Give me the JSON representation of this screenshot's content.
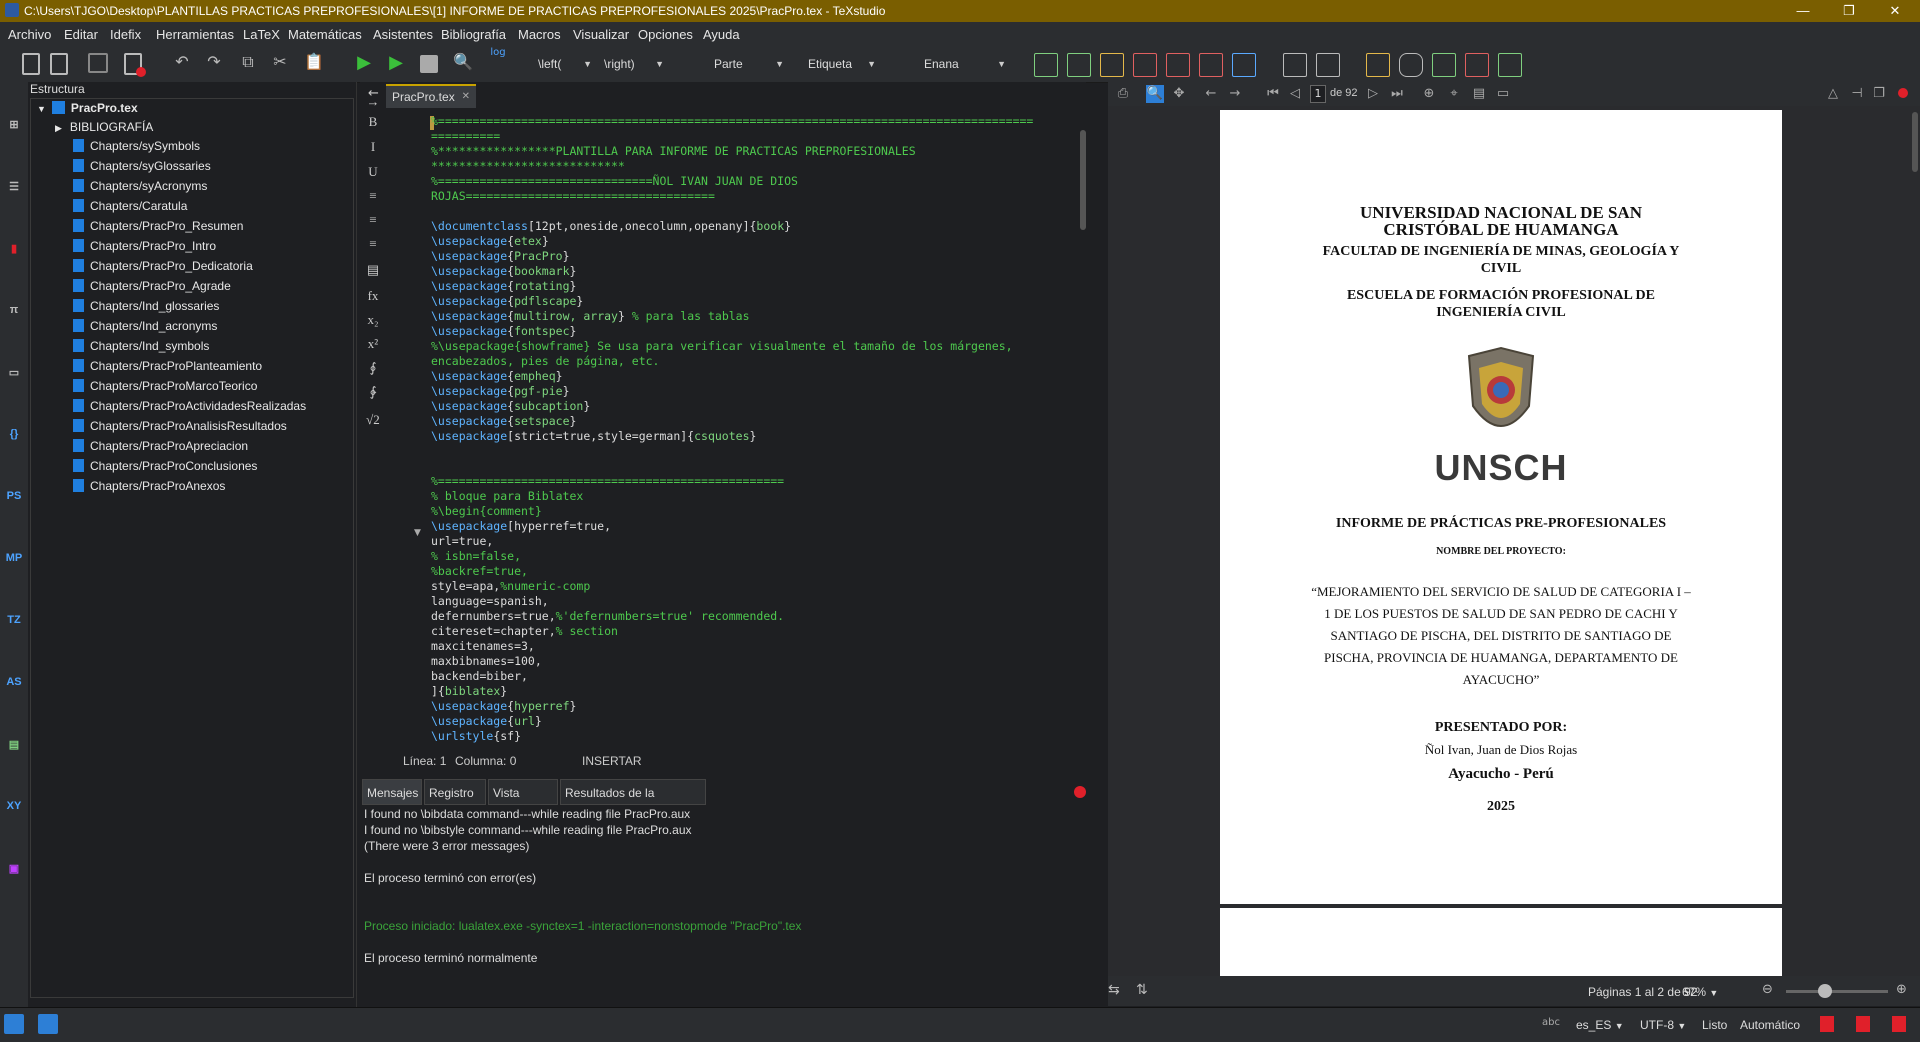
{
  "window": {
    "title": "C:\\Users\\TJGO\\Desktop\\PLANTILLAS PRACTICAS PREPROFESIONALES\\[1] INFORME DE PRACTICAS PREPROFESIONALES 2025\\PracPro.tex - TeXstudio",
    "minimize": "—",
    "maximize": "❐",
    "close": "✕"
  },
  "menu": [
    "Archivo",
    "Editar",
    "Idefix",
    "Herramientas",
    "LaTeX",
    "Matemáticas",
    "Asistentes",
    "Bibliografía",
    "Macros",
    "Visualizar",
    "Opciones",
    "Ayuda"
  ],
  "toolbar": {
    "left_cmd": "\\left(",
    "right_cmd": "\\right)",
    "part": "Parte",
    "label": "Etiqueta",
    "size": "Enana",
    "log": "log"
  },
  "structure": {
    "header": "Estructura",
    "root": "PracPro.tex",
    "bibliography": "BIBLIOGRAFÍA",
    "items": [
      "Chapters/sySymbols",
      "Chapters/syGlossaries",
      "Chapters/syAcronyms",
      "Chapters/Caratula",
      "Chapters/PracPro_Resumen",
      "Chapters/PracPro_Intro",
      "Chapters/PracPro_Dedicatoria",
      "Chapters/PracPro_Agrade",
      "Chapters/Ind_glossaries",
      "Chapters/Ind_acronyms",
      "Chapters/Ind_symbols",
      "Chapters/PracProPlanteamiento",
      "Chapters/PracProMarcoTeorico",
      "Chapters/PracProActividadesRealizadas",
      "Chapters/PracProAnalisisResultados",
      "Chapters/PracProApreciacion",
      "Chapters/PracProConclusiones",
      "Chapters/PracProAnexos"
    ]
  },
  "editor_strip": [
    "→",
    "B",
    "I",
    "U",
    "≡",
    "≡",
    "≡",
    "▤",
    "fx",
    "x₂",
    "x²",
    "∮",
    "∲",
    "√2"
  ],
  "tab": {
    "label": "PracPro.tex",
    "close": "✕"
  },
  "code": [
    [
      [
        "cm",
        "%======================================================================================"
      ]
    ],
    [
      [
        "cm",
        "=========="
      ]
    ],
    [
      [
        "cm",
        "%*****************PLANTILLA PARA INFORME DE PRACTICAS PREPROFESIONALES"
      ]
    ],
    [
      [
        "cm",
        "****************************"
      ]
    ],
    [
      [
        "cm",
        "%===============================ÑOL IVAN JUAN DE DIOS"
      ]
    ],
    [
      [
        "cm",
        "ROJAS===================================="
      ]
    ],
    [
      [
        "tx",
        ""
      ]
    ],
    [
      [
        "kw",
        "\\documentclass"
      ],
      [
        "tx",
        "[12pt,oneside,onecolumn,openany]{"
      ],
      [
        "br",
        "book"
      ],
      [
        "tx",
        "}"
      ]
    ],
    [
      [
        "kw",
        "\\usepackage"
      ],
      [
        "tx",
        "{"
      ],
      [
        "br",
        "etex"
      ],
      [
        "tx",
        "}"
      ]
    ],
    [
      [
        "kw",
        "\\usepackage"
      ],
      [
        "tx",
        "{"
      ],
      [
        "br",
        "PracPro"
      ],
      [
        "tx",
        "}"
      ]
    ],
    [
      [
        "kw",
        "\\usepackage"
      ],
      [
        "tx",
        "{"
      ],
      [
        "br",
        "bookmark"
      ],
      [
        "tx",
        "}"
      ]
    ],
    [
      [
        "kw",
        "\\usepackage"
      ],
      [
        "tx",
        "{"
      ],
      [
        "br",
        "rotating"
      ],
      [
        "tx",
        "}"
      ]
    ],
    [
      [
        "kw",
        "\\usepackage"
      ],
      [
        "tx",
        "{"
      ],
      [
        "br",
        "pdflscape"
      ],
      [
        "tx",
        "}"
      ]
    ],
    [
      [
        "kw",
        "\\usepackage"
      ],
      [
        "tx",
        "{"
      ],
      [
        "br",
        "multirow, array"
      ],
      [
        "tx",
        "} "
      ],
      [
        "cm",
        "% para las tablas"
      ]
    ],
    [
      [
        "kw",
        "\\usepackage"
      ],
      [
        "tx",
        "{"
      ],
      [
        "br",
        "fontspec"
      ],
      [
        "tx",
        "}"
      ]
    ],
    [
      [
        "cm",
        "%\\usepackage{showframe} Se usa para verificar visualmente el tamaño de los márgenes,"
      ]
    ],
    [
      [
        "cm",
        "encabezados, pies de página, etc."
      ]
    ],
    [
      [
        "kw",
        "\\usepackage"
      ],
      [
        "tx",
        "{"
      ],
      [
        "br",
        "empheq"
      ],
      [
        "tx",
        "}"
      ]
    ],
    [
      [
        "kw",
        "\\usepackage"
      ],
      [
        "tx",
        "{"
      ],
      [
        "br",
        "pgf-pie"
      ],
      [
        "tx",
        "}"
      ]
    ],
    [
      [
        "kw",
        "\\usepackage"
      ],
      [
        "tx",
        "{"
      ],
      [
        "br",
        "subcaption"
      ],
      [
        "tx",
        "}"
      ]
    ],
    [
      [
        "kw",
        "\\usepackage"
      ],
      [
        "tx",
        "{"
      ],
      [
        "br",
        "setspace"
      ],
      [
        "tx",
        "}"
      ]
    ],
    [
      [
        "kw",
        "\\usepackage"
      ],
      [
        "tx",
        "[strict=true,style=german]{"
      ],
      [
        "br",
        "csquotes"
      ],
      [
        "tx",
        "}"
      ]
    ],
    [
      [
        "tx",
        ""
      ]
    ],
    [
      [
        "tx",
        ""
      ]
    ],
    [
      [
        "cm",
        "%=================================================="
      ]
    ],
    [
      [
        "cm",
        "% bloque para Biblatex"
      ]
    ],
    [
      [
        "cm",
        "%\\begin{comment}"
      ]
    ],
    [
      [
        "kw",
        "\\usepackage"
      ],
      [
        "tx",
        "[hyperref=true,"
      ]
    ],
    [
      [
        "tx",
        "url=true,"
      ]
    ],
    [
      [
        "cm",
        "% isbn=false,"
      ]
    ],
    [
      [
        "cm",
        "%backref=true,"
      ]
    ],
    [
      [
        "tx",
        "style=apa,"
      ],
      [
        "cm",
        "%numeric-comp"
      ]
    ],
    [
      [
        "tx",
        "language=spanish,"
      ]
    ],
    [
      [
        "tx",
        "defernumbers=true,"
      ],
      [
        "cm",
        "%'defernumbers=true' recommended."
      ]
    ],
    [
      [
        "tx",
        "citereset=chapter,"
      ],
      [
        "cm",
        "% section"
      ]
    ],
    [
      [
        "tx",
        "maxcitenames=3,"
      ]
    ],
    [
      [
        "tx",
        "maxbibnames=100,"
      ]
    ],
    [
      [
        "tx",
        "backend=biber,"
      ]
    ],
    [
      [
        "tx",
        "]{"
      ],
      [
        "br",
        "biblatex"
      ],
      [
        "tx",
        "}"
      ]
    ],
    [
      [
        "kw",
        "\\usepackage"
      ],
      [
        "tx",
        "{"
      ],
      [
        "br",
        "hyperref"
      ],
      [
        "tx",
        "}"
      ]
    ],
    [
      [
        "kw",
        "\\usepackage"
      ],
      [
        "tx",
        "{"
      ],
      [
        "br",
        "url"
      ],
      [
        "tx",
        "}"
      ]
    ],
    [
      [
        "kw",
        "\\urlstyle"
      ],
      [
        "tx",
        "{sf}"
      ]
    ]
  ],
  "status": {
    "line": "Línea: 1",
    "column": "Columna: 0",
    "mode": "INSERTAR"
  },
  "msg_tabs": [
    "Mensajes",
    "Registro",
    "Vista previa",
    "Resultados de la Búsqueda"
  ],
  "messages": [
    {
      "t": "I found no \\bibdata command---while reading file PracPro.aux",
      "c": "#dddddd"
    },
    {
      "t": "I found no \\bibstyle command---while reading file PracPro.aux",
      "c": "#dddddd"
    },
    {
      "t": "(There were 3 error messages)",
      "c": "#dddddd"
    },
    {
      "t": "",
      "c": "#dddddd"
    },
    {
      "t": "El proceso terminó con error(es)",
      "c": "#dddddd"
    },
    {
      "t": "",
      "c": "#dddddd"
    },
    {
      "t": "",
      "c": "#dddddd"
    },
    {
      "t": "Proceso iniciado: lualatex.exe -synctex=1 -interaction=nonstopmode \"PracPro\".tex",
      "c": "#3aa33a"
    },
    {
      "t": "",
      "c": "#dddddd"
    },
    {
      "t": "El proceso terminó normalmente",
      "c": "#dddddd"
    }
  ],
  "pdf": {
    "page_input": "1",
    "page_total": "de 92",
    "page1": {
      "univ1": "UNIVERSIDAD NACIONAL DE SAN",
      "univ2": "CRISTÓBAL DE HUAMANGA",
      "fac1": "FACULTAD DE INGENIERÍA DE MINAS, GEOLOGÍA Y",
      "fac2": "CIVIL",
      "esc1": "ESCUELA DE FORMACIÓN PROFESIONAL DE",
      "esc2": "INGENIERÍA CIVIL",
      "logo_text": "UNSCH",
      "informe": "INFORME DE PRÁCTICAS PRE-PROFESIONALES",
      "nombre": "NOMBRE DEL PROYECTO:",
      "proyecto": [
        "“MEJORAMIENTO DEL SERVICIO DE SALUD DE CATEGORIA I –",
        "1 DE LOS PUESTOS DE SALUD DE SAN PEDRO DE CACHI Y",
        "SANTIAGO DE PISCHA, DEL DISTRITO DE SANTIAGO DE",
        "PISCHA, PROVINCIA DE HUAMANGA, DEPARTAMENTO DE",
        "AYACUCHO”"
      ],
      "presentado": "PRESENTADO POR:",
      "autor": "Ñol Ivan, Juan de Dios Rojas",
      "lugar": "Ayacucho - Perú",
      "anio": "2025"
    },
    "pages_label": "Páginas 1 al 2 de 92",
    "zoom": "67%"
  },
  "bottom": {
    "lang": "es_ES",
    "encoding": "UTF-8",
    "state": "Listo",
    "auto": "Automático",
    "spell": "abc"
  }
}
